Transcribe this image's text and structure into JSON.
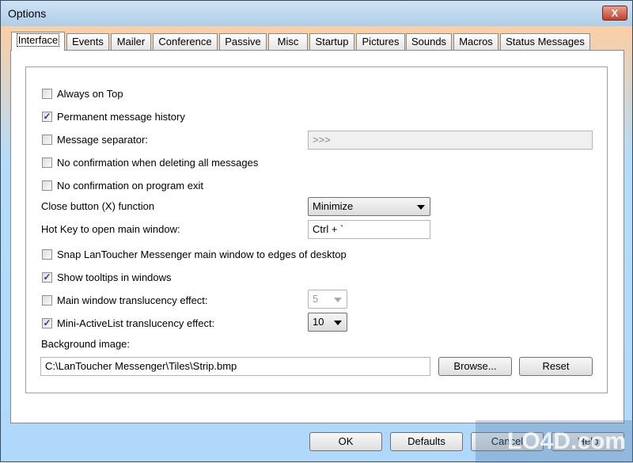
{
  "window": {
    "title": "Options",
    "close_icon": "X"
  },
  "tabs": [
    {
      "label": "Interface",
      "active": true
    },
    {
      "label": "Events"
    },
    {
      "label": "Mailer"
    },
    {
      "label": "Conference"
    },
    {
      "label": "Passive"
    },
    {
      "label": "Misc"
    },
    {
      "label": "Startup"
    },
    {
      "label": "Pictures"
    },
    {
      "label": "Sounds"
    },
    {
      "label": "Macros"
    },
    {
      "label": "Status Messages"
    }
  ],
  "interface": {
    "always_on_top": {
      "label": "Always on Top",
      "checked": false
    },
    "permanent_history": {
      "label": "Permanent message history",
      "checked": true
    },
    "message_separator": {
      "label": "Message separator:",
      "checked": false,
      "value": ">>>"
    },
    "no_confirm_delete": {
      "label": "No confirmation when deleting all messages",
      "checked": false
    },
    "no_confirm_exit": {
      "label": "No confirmation on program exit",
      "checked": false
    },
    "close_button": {
      "label": "Close button (X) function",
      "value": "Minimize"
    },
    "hot_key": {
      "label": "Hot Key to open main window:",
      "value": "Ctrl + `"
    },
    "snap": {
      "label": "Snap LanToucher Messenger main window to edges of desktop",
      "checked": false
    },
    "tooltips": {
      "label": "Show tooltips in windows",
      "checked": true
    },
    "main_translucency": {
      "label": "Main window translucency effect:",
      "checked": false,
      "value": "5"
    },
    "mini_translucency": {
      "label": "Mini-ActiveList translucency effect:",
      "checked": true,
      "value": "10"
    },
    "background": {
      "label": "Background image:",
      "value": "C:\\LanToucher Messenger\\Tiles\\Strip.bmp",
      "browse": "Browse...",
      "reset": "Reset"
    }
  },
  "buttons": {
    "ok": "OK",
    "defaults": "Defaults",
    "cancel": "Cancel",
    "help": "Help"
  },
  "watermark": "LO4D.com"
}
